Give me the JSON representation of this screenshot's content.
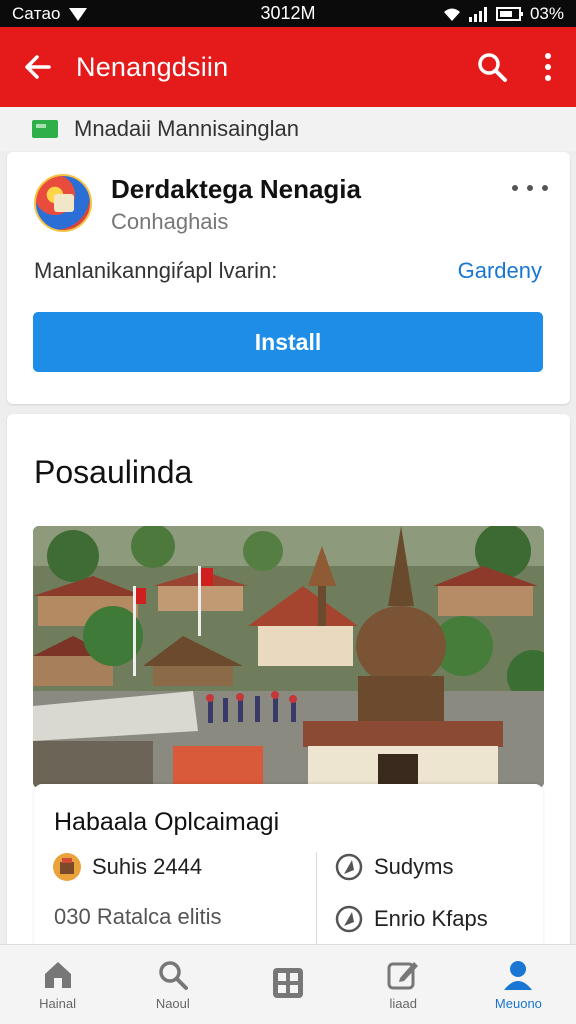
{
  "status_bar": {
    "carrier": "Caтao",
    "time": "3012M",
    "battery": "03%"
  },
  "app_bar": {
    "title": "Nenangdsiin",
    "icons": [
      "back-arrow-icon",
      "search-icon",
      "more-vertical-icon"
    ]
  },
  "subheader": {
    "text": "Mnadaii Mannisainglan",
    "icon": "flag-icon"
  },
  "app_card": {
    "name": "Derdaktega Nenagia",
    "category": "Conhaghais",
    "info_text": "Manlanikanngiŕapl lvarin:",
    "info_link": "Gardeny",
    "install_label": "Install"
  },
  "section": {
    "title": "Posaulinda",
    "panel_title": "Habaala Oplcaimagi",
    "stats": [
      {
        "label": "Suhis 2444",
        "icon": "badge-icon"
      },
      {
        "label": "Sudyms",
        "icon": "compass-icon"
      },
      {
        "label": "030 Ratalca elitis",
        "icon": "none"
      },
      {
        "label": "Enrio Kfaps",
        "icon": "compass-icon"
      }
    ]
  },
  "bottom_nav": [
    {
      "label": "Hainal",
      "icon": "home-icon"
    },
    {
      "label": "Naoul",
      "icon": "search-icon"
    },
    {
      "label": "",
      "icon": "grid-icon"
    },
    {
      "label": "liaad",
      "icon": "edit-icon"
    },
    {
      "label": "Meuono",
      "icon": "profile-icon"
    }
  ],
  "colors": {
    "app_bar": "#e51b1b",
    "install_button": "#1e8de8",
    "link": "#1976d2",
    "active_nav": "#1976d2"
  }
}
